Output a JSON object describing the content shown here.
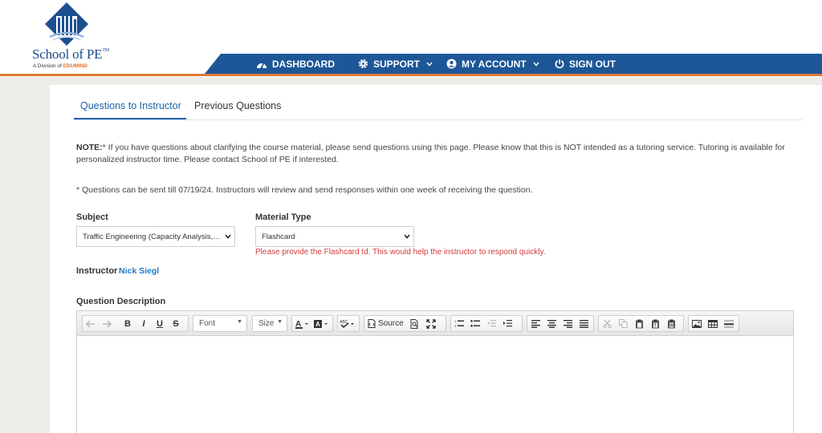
{
  "brand": {
    "name": "School of PE",
    "trademark": "TM",
    "division_prefix": "A Division of",
    "division_name": "EDUMIND"
  },
  "nav": {
    "dashboard": "DASHBOARD",
    "support": "SUPPORT",
    "my_account": "MY ACCOUNT",
    "sign_out": "SIGN OUT"
  },
  "tabs": {
    "active": "Questions to Instructor",
    "previous": "Previous Questions"
  },
  "note": {
    "label": "NOTE:",
    "text": "* If you have questions about clarifying the course material, please send questions using this page. Please know that this is NOT intended as a tutoring service. Tutoring is available for personalized instructor time. Please contact School of PE if interested."
  },
  "deadline": "* Questions can be sent till 07/19/24. Instructors will review and send responses within one week of receiving the question.",
  "form": {
    "subject_label": "Subject",
    "subject_value": "Traffic Engineering (Capacity Analysis, Highway Safety, etc.)",
    "material_label": "Material Type",
    "material_value": "Flashcard",
    "error": "Please provide the Flashcard Id. This would help the instructor to respond quickly.",
    "instructor_label": "Instructor",
    "instructor_name": "Nick Siegl",
    "description_label": "Question Description"
  },
  "toolbar": {
    "font": "Font",
    "size": "Size",
    "source": "Source"
  },
  "colors": {
    "nav_blue": "#1d5797",
    "accent_orange": "#e07a30",
    "link_blue": "#1e63ab",
    "error_red": "#d23b3b"
  }
}
